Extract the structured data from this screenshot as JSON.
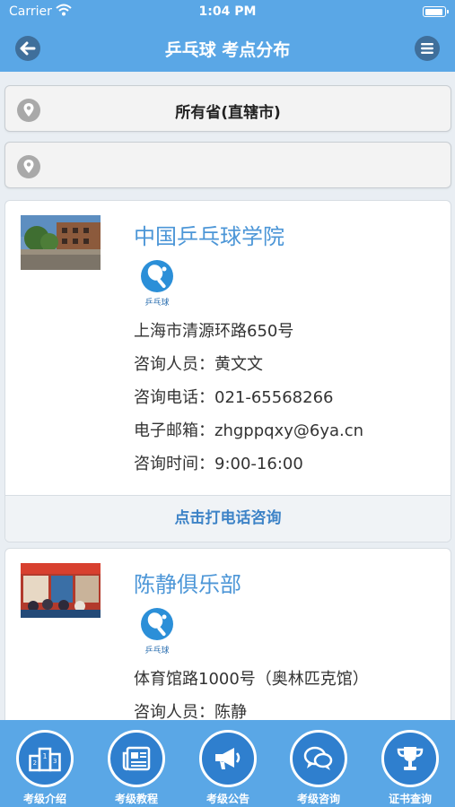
{
  "status_bar": {
    "carrier": "Carrier",
    "time": "1:04 PM"
  },
  "nav": {
    "title": "乒乓球 考点分布",
    "back_icon": "back-arrow-icon",
    "menu_icon": "menu-icon"
  },
  "filters": {
    "province": {
      "value": "所有省(直辖市)"
    },
    "city": {
      "value": ""
    }
  },
  "cards": [
    {
      "title": "中国乒乓球学院",
      "logo_text": "乒乓球",
      "address": "上海市清源环路650号",
      "contact_label": "咨询人员：",
      "contact": "黄文文",
      "phone_label": "咨询电话：",
      "phone": "021-65568266",
      "email_label": "电子邮箱：",
      "email": "zhgppqxy@6ya.cn",
      "hours_label": "咨询时间：",
      "hours": "9:00-16:00",
      "call_label": "点击打电话咨询"
    },
    {
      "title": "陈静俱乐部",
      "logo_text": "乒乓球",
      "address": "体育馆路1000号（奥林匹克馆）",
      "contact_label": "咨询人员：",
      "contact": "陈静"
    }
  ],
  "tabbar": [
    {
      "label": "考级介绍",
      "icon": "podium-icon"
    },
    {
      "label": "考级教程",
      "icon": "newspaper-icon"
    },
    {
      "label": "考级公告",
      "icon": "megaphone-icon"
    },
    {
      "label": "考级咨询",
      "icon": "chat-bubbles-icon"
    },
    {
      "label": "证书查询",
      "icon": "trophy-icon"
    }
  ]
}
